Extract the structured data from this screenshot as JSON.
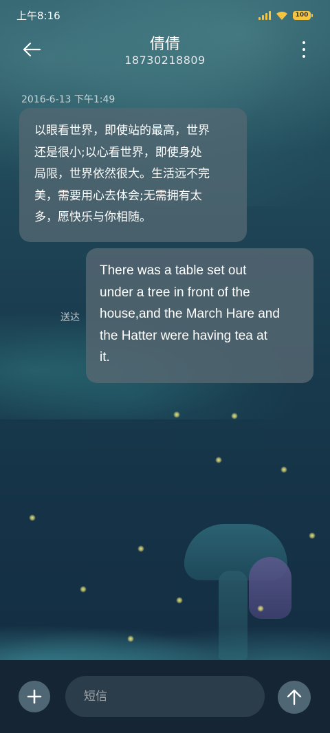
{
  "status_bar": {
    "time": "上午8:16",
    "battery_level": "100",
    "icons": [
      "signal-icon",
      "wifi-icon",
      "battery-icon"
    ],
    "accent_color": "#f5c542"
  },
  "header": {
    "contact_name": "倩倩",
    "contact_number": "18730218809",
    "back_icon": "arrow-left-icon",
    "more_icon": "more-vertical-icon"
  },
  "conversation": {
    "timestamp": "2016-6-13 下午1:49",
    "messages": [
      {
        "direction": "incoming",
        "lines": [
          "以眼看世界，即使站的最高，世界",
          "还是很小;以心看世界，即使身处",
          "局限，世界依然很大。生活远不完",
          "美，需要用心去体会;无需拥有太",
          "多，愿快乐与你相随。"
        ]
      },
      {
        "direction": "outgoing",
        "status": "送达",
        "lines": [
          "There was a table set out",
          "under a tree in front of the",
          "house,and the March Hare and",
          "the Hatter were having tea at",
          "it."
        ]
      }
    ]
  },
  "composer": {
    "placeholder": "短信",
    "value": "",
    "attach_icon": "plus-icon",
    "send_icon": "arrow-up-icon"
  }
}
